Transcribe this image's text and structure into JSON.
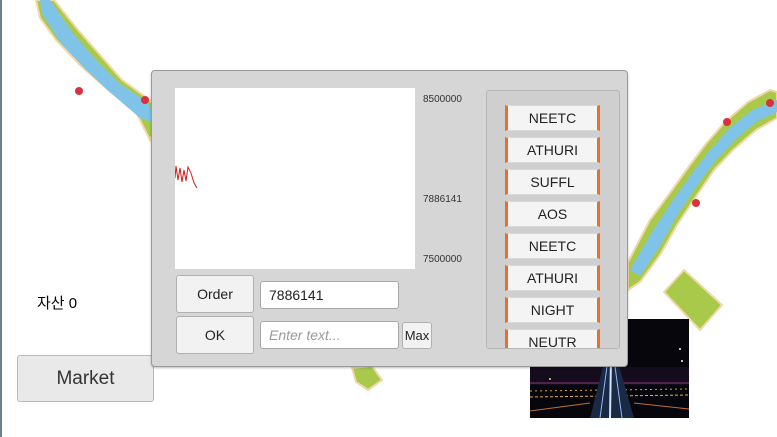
{
  "hud": {
    "asset_label": "자산 0",
    "market_button": "Market"
  },
  "order_panel": {
    "graph_labels": [
      "8500000",
      "7886141",
      "7500000"
    ],
    "order_button": "Order",
    "ok_button": "OK",
    "price_value": "7886141",
    "quantity_placeholder": "Enter text...",
    "max_button": "Max",
    "stock_list": [
      "NEETC",
      "ATHURI",
      "SUFFL",
      "AOS",
      "NEETC",
      "ATHURI",
      "NIGHT",
      "NEUTR"
    ]
  },
  "colors": {
    "river": "#7fc3e8",
    "grass": "#a9c94a",
    "marker": "#d8323e",
    "list_accent": "#e8702a",
    "graph_line": "#cc1f1f"
  },
  "icons": {
    "map_marker": "red-dot-marker"
  }
}
